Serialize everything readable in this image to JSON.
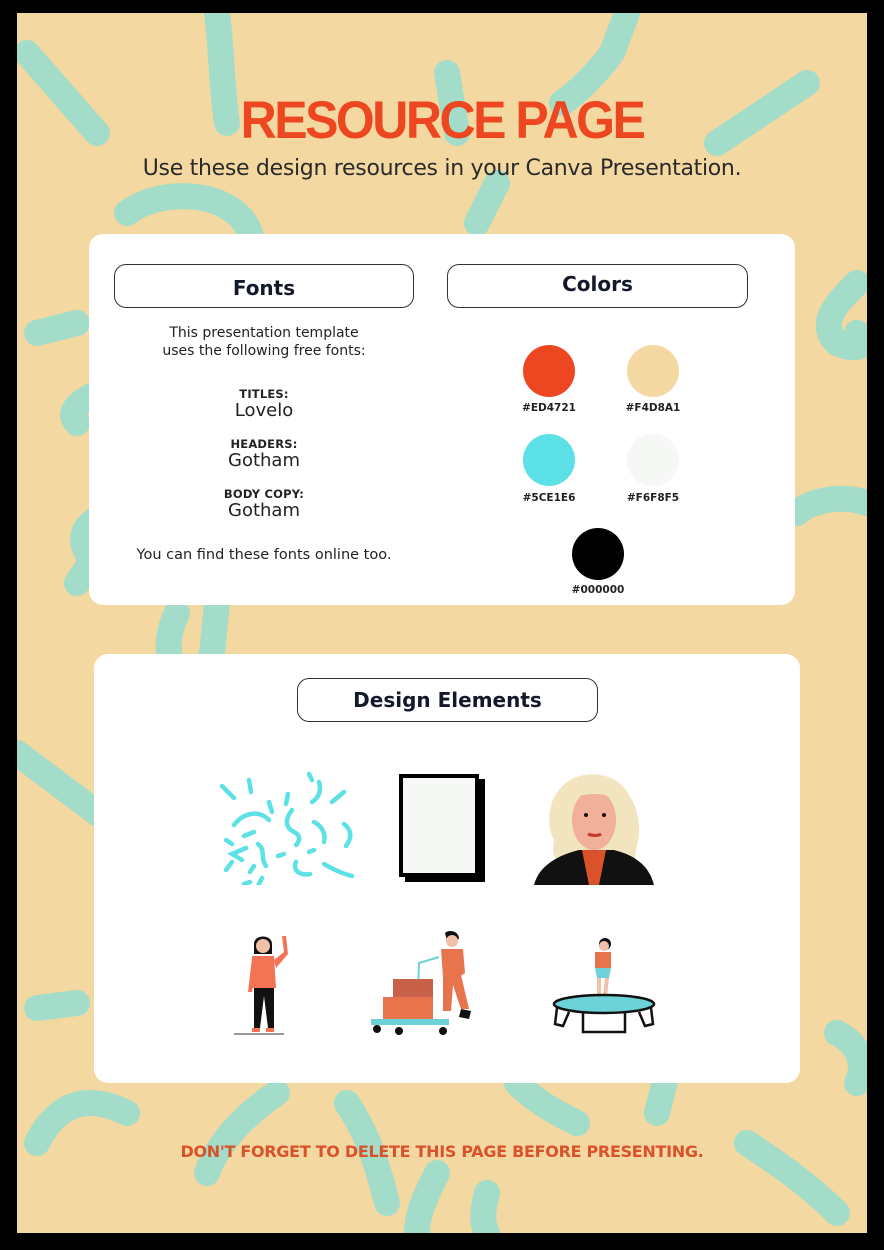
{
  "header": {
    "title": "RESOURCE PAGE",
    "subtitle": "Use these design resources in your Canva Presentation."
  },
  "fonts_section": {
    "heading": "Fonts",
    "intro_line1": "This presentation template",
    "intro_line2": "uses the following free fonts:",
    "entries": [
      {
        "label": "TITLES:",
        "font": "Lovelo"
      },
      {
        "label": "HEADERS:",
        "font": "Gotham"
      },
      {
        "label": "BODY COPY:",
        "font": "Gotham"
      }
    ],
    "footer": "You can find these fonts online too."
  },
  "colors_section": {
    "heading": "Colors",
    "swatches": [
      {
        "label": "#ED4721",
        "color": "#ED4721"
      },
      {
        "label": "#F4D8A1",
        "color": "#F4D8A1"
      },
      {
        "label": "#5CE1E6",
        "color": "#5CE1E6"
      },
      {
        "label": "#F6F8F5",
        "color": "#F6F8F5"
      },
      {
        "label": "#000000",
        "color": "#000000"
      }
    ]
  },
  "design_elements_section": {
    "heading": "Design Elements",
    "items": [
      {
        "icon": "squiggle-pattern-icon"
      },
      {
        "icon": "blank-frame-icon"
      },
      {
        "icon": "portrait-illustration-icon"
      },
      {
        "icon": "waving-woman-illustration-icon"
      },
      {
        "icon": "delivery-man-cart-illustration-icon"
      },
      {
        "icon": "trampoline-kid-illustration-icon"
      }
    ]
  },
  "footer": {
    "note": "DON'T FORGET TO DELETE THIS PAGE BEFORE PRESENTING."
  },
  "theme": {
    "accent": "#ED4721",
    "background": "#F4D8A1",
    "squiggle": "#A3DCC8",
    "card": "#FFFFFF",
    "border": "#000000"
  }
}
